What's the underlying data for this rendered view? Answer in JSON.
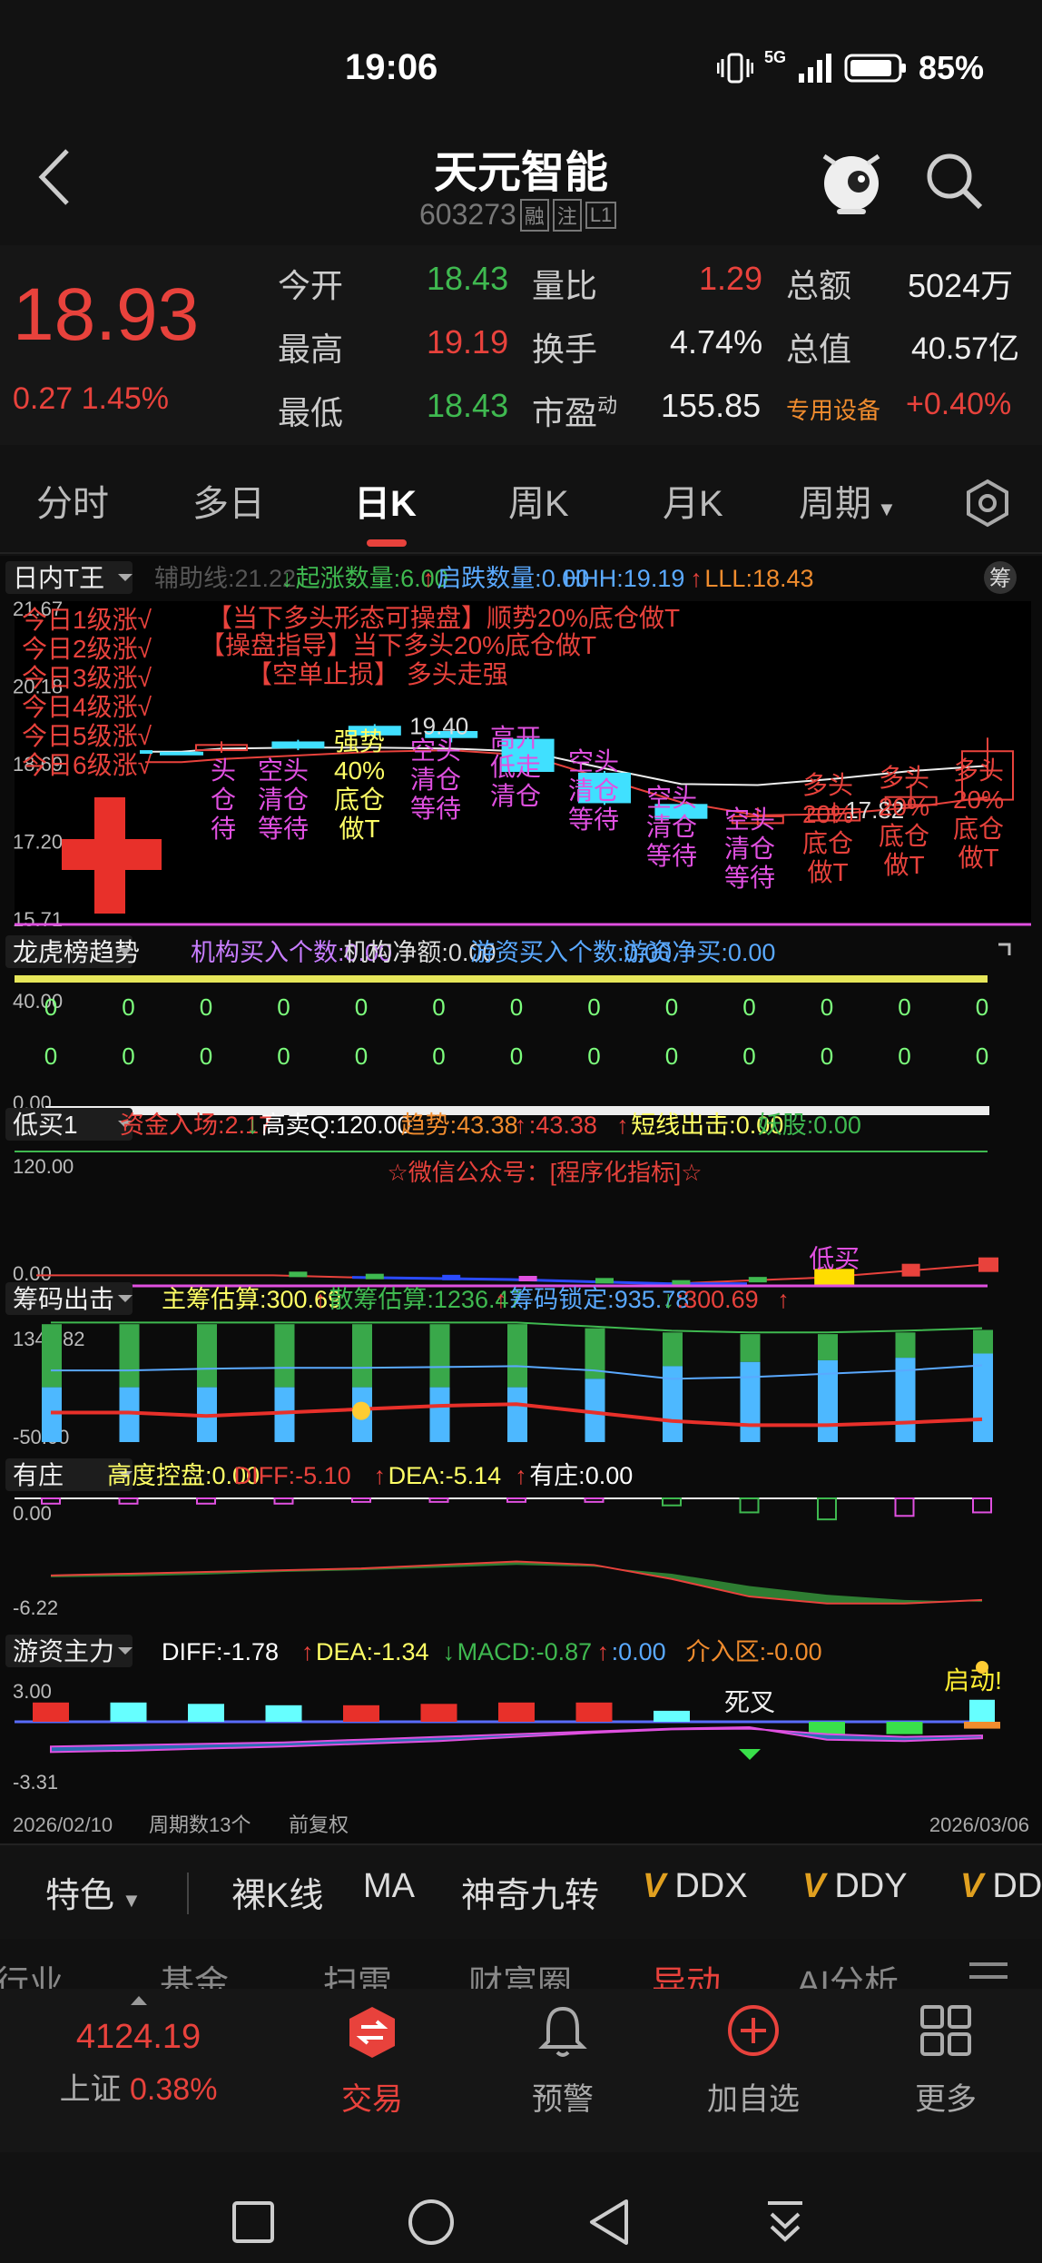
{
  "status": {
    "time": "19:06",
    "signal": "5G",
    "battery": "85%"
  },
  "header": {
    "title": "天元智能",
    "code": "603273",
    "tags": [
      "融",
      "注",
      "L1"
    ]
  },
  "quote": {
    "price": "18.93",
    "change": "0.27 1.45%",
    "open_label": "今开",
    "open": "18.43",
    "high_label": "最高",
    "high": "19.19",
    "low_label": "最低",
    "low": "18.43",
    "volratio_label": "量比",
    "volratio": "1.29",
    "turnover_label": "换手",
    "turnover": "4.74%",
    "pe_label": "市盈",
    "pe_sup": "动",
    "pe": "155.85",
    "amount_label": "总额",
    "amount": "5024万",
    "mktcap_label": "总值",
    "mktcap": "40.57亿",
    "sector": "专用设备",
    "sector_change": "+0.40%"
  },
  "tabs": [
    {
      "label": "分时"
    },
    {
      "label": "多日"
    },
    {
      "label": "日K"
    },
    {
      "label": "周K"
    },
    {
      "label": "月K"
    },
    {
      "label": "周期"
    }
  ],
  "panel1": {
    "name": "日内T王",
    "fields": [
      {
        "text": "辅助线:21.22",
        "color": "#555555"
      },
      {
        "text": "↓",
        "color": "#3fb950"
      },
      {
        "text": "起涨数量:6.00",
        "color": "#3fb950"
      },
      {
        "text": "↑",
        "color": "#e8423c"
      },
      {
        "text": "启跌数量:0.00",
        "color": "#5aa9ff"
      },
      {
        "text": "HHH:19.19",
        "color": "#5aa9ff"
      },
      {
        "text": "↑",
        "color": "#e8423c"
      },
      {
        "text": "LLL:18.43",
        "color": "#f08c2e"
      }
    ],
    "chip": "筹",
    "y_ticks": [
      "21.67",
      "20.18",
      "18.69",
      "17.20",
      "15.71"
    ],
    "left_labels": [
      "今日1级涨√",
      "今日2级涨√",
      "今日3级涨√",
      "今日4级涨√",
      "今日5级涨√",
      "今日6级涨√"
    ],
    "top_notes": [
      "【当下多头形态可操盘】顺势20%底仓做T",
      "【操盘指导】当下多头20%底仓做T",
      "【空单止损】 多头走强"
    ],
    "price_tag_1": "19.40",
    "price_tag_2": "17.82",
    "candle_labels": [
      {
        "line1": "头",
        "line2": "仓",
        "line3": "待"
      },
      {
        "line1": "空头",
        "line2": "清仓",
        "line3": "等待"
      },
      {
        "line1": "强势",
        "line2": "40%",
        "line3": "底仓",
        "line4": "做T"
      },
      {
        "line1": "空头",
        "line2": "清仓",
        "line3": "等待"
      },
      {
        "line1": "高开",
        "line2": "低走",
        "line3": "清仓"
      },
      {
        "line1": "空头",
        "line2": "清仓",
        "line3": "等待"
      },
      {
        "line1": "空头",
        "line2": "清仓",
        "line3": "等待"
      },
      {
        "line1": "空头",
        "line2": "清仓",
        "line3": "等待"
      },
      {
        "line1": "多头",
        "line2": "20%",
        "line3": "底仓",
        "line4": "做T"
      },
      {
        "line1": "多头",
        "line2": "20%",
        "line3": "底仓",
        "line4": "做T"
      },
      {
        "line1": "多头",
        "line2": "20%",
        "line3": "底仓",
        "line4": "做T"
      }
    ]
  },
  "panel2": {
    "name": "龙虎榜趋势",
    "fields": [
      {
        "text": "机构买入个数:0.00",
        "color": "#c77dff"
      },
      {
        "text": "机构净额:0.00",
        "color": "#dddddd"
      },
      {
        "text": "游资买入个数:0.00",
        "color": "#5aa9ff"
      },
      {
        "text": "游资净买:0.00",
        "color": "#5aa9ff"
      }
    ],
    "y_ticks": [
      "40.00",
      "0.00"
    ],
    "zero_label": "0"
  },
  "panel3": {
    "name": "低买1",
    "fields": [
      {
        "text": "资金入场:2.17",
        "color": "#e8423c"
      },
      {
        "text": "↓",
        "color": "#3fb950"
      },
      {
        "text": "高卖Q:120.00",
        "color": "#ffffff"
      },
      {
        "text": "趋势:43.38",
        "color": "#f08c2e"
      },
      {
        "text": "↑",
        "color": "#e8423c"
      },
      {
        "text": ":43.38",
        "color": "#e8423c"
      },
      {
        "text": "↑",
        "color": "#e8423c"
      },
      {
        "text": "短线出击:0.00",
        "color": "#ffff66"
      },
      {
        "text": "妖股:0.00",
        "color": "#3fb950"
      }
    ],
    "y_ticks": [
      "120.00",
      "0.00"
    ],
    "watermark": "☆微信公众号：[程序化指标]☆",
    "lowbuy": "低买"
  },
  "panel4": {
    "name": "筹码出击",
    "fields": [
      {
        "text": "主筹估算:300.69",
        "color": "#ffff66"
      },
      {
        "text": "↑",
        "color": "#e8423c"
      },
      {
        "text": "散筹估算:1236.47",
        "color": "#3fb950"
      },
      {
        "text": "↑",
        "color": "#e8423c"
      },
      {
        "text": "筹码锁定:935.78",
        "color": "#5aa9ff"
      },
      {
        "text": "↓",
        "color": "#3fb950"
      },
      {
        "text": ":300.69",
        "color": "#e8423c"
      },
      {
        "text": "↑",
        "color": "#e8423c"
      }
    ],
    "y_ticks": [
      "1348.82",
      "-50.00"
    ]
  },
  "panel5": {
    "name": "有庄",
    "fields": [
      {
        "text": "高度控盘:0.00",
        "color": "#ffff66"
      },
      {
        "text": "DIFF:-5.10",
        "color": "#e8423c"
      },
      {
        "text": "↑",
        "color": "#e8423c"
      },
      {
        "text": "DEA:-5.14",
        "color": "#ffff66"
      },
      {
        "text": "↑",
        "color": "#e8423c"
      },
      {
        "text": "有庄:0.00",
        "color": "#ffffff"
      }
    ],
    "y_ticks": [
      "0.00",
      "-6.22"
    ]
  },
  "panel6": {
    "name": "游资主力",
    "fields": [
      {
        "text": "DIFF:-1.78",
        "color": "#ffffff"
      },
      {
        "text": "↑",
        "color": "#e8423c"
      },
      {
        "text": "DEA:-1.34",
        "color": "#ffff66"
      },
      {
        "text": "↓",
        "color": "#3fb950"
      },
      {
        "text": "MACD:-0.87",
        "color": "#3fb950"
      },
      {
        "text": "↑",
        "color": "#e8423c"
      },
      {
        "text": ":0.00",
        "color": "#5aa9ff"
      },
      {
        "text": "介入区:-0.00",
        "color": "#f08c2e"
      }
    ],
    "y_ticks": [
      "3.00",
      "-3.31"
    ],
    "death_cross": "死叉",
    "start_label": "启动!"
  },
  "axis_footer": {
    "start": "2026/02/10",
    "periods": "周期数13个",
    "adjust": "前复权",
    "end": "2026/03/06"
  },
  "features": [
    {
      "label": "特色",
      "dropdown": true
    },
    {
      "label": "裸K线"
    },
    {
      "label": "MA"
    },
    {
      "label": "神奇九转"
    },
    {
      "label": "DDX",
      "v": true
    },
    {
      "label": "DDY",
      "v": true
    },
    {
      "label": "DD",
      "v": true
    }
  ],
  "subbar": [
    {
      "label": "行业"
    },
    {
      "label": "基金"
    },
    {
      "label": "扫雷"
    },
    {
      "label": "财富圈"
    },
    {
      "label": "异动"
    },
    {
      "label": "AI分析"
    }
  ],
  "index": {
    "value": "4124.19",
    "name": "上证",
    "change": "0.38%"
  },
  "nav": [
    {
      "label": "交易"
    },
    {
      "label": "预警"
    },
    {
      "label": "加自选"
    },
    {
      "label": "更多"
    }
  ],
  "colors": {
    "up": "#e8423c",
    "down": "#3fb950",
    "accent": "#e8423c",
    "blue": "#5aa9ff",
    "magenta": "#e050e0"
  }
}
